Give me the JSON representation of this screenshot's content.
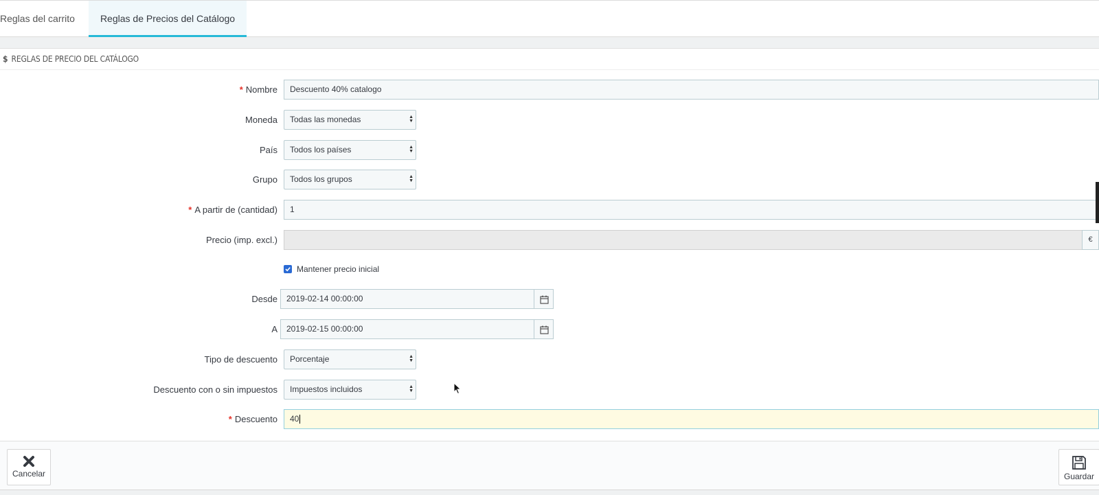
{
  "tabs": [
    {
      "label": "Reglas del carrito",
      "active": false
    },
    {
      "label": "Reglas de Precios del Catálogo",
      "active": true
    }
  ],
  "panel": {
    "currency_symbol": "$",
    "title": "Reglas de precio del catálogo"
  },
  "form": {
    "nombre": {
      "label": "Nombre",
      "required": true,
      "value": "Descuento 40% catalogo"
    },
    "moneda": {
      "label": "Moneda",
      "value": "Todas las monedas"
    },
    "pais": {
      "label": "País",
      "value": "Todos los países"
    },
    "grupo": {
      "label": "Grupo",
      "value": "Todos los grupos"
    },
    "cantidad": {
      "label": "A partir de (cantidad)",
      "required": true,
      "value": "1"
    },
    "precio": {
      "label": "Precio (imp. excl.)",
      "value": "",
      "addon": "€",
      "disabled": true
    },
    "mantener": {
      "label": "Mantener precio inicial",
      "checked": true
    },
    "desde": {
      "label": "Desde",
      "value": "2019-02-14 00:00:00"
    },
    "a": {
      "label": "A",
      "value": "2019-02-15 00:00:00"
    },
    "tipo": {
      "label": "Tipo de descuento",
      "value": "Porcentaje"
    },
    "impuestos": {
      "label": "Descuento con o sin impuestos",
      "value": "Impuestos incluidos"
    },
    "descuento": {
      "label": "Descuento",
      "required": true,
      "value": "40"
    }
  },
  "footer": {
    "cancel_label": "Cancelar",
    "save_label": "Guardar"
  },
  "icons": {
    "cancel": "close-icon",
    "save": "save-icon",
    "calendar": "calendar-icon",
    "select_arrows": "sort-arrows-icon"
  },
  "colors": {
    "accent": "#25b9d7",
    "required": "#e5332a",
    "checkbox": "#2a6ad4",
    "active_input": "#fefbe2"
  }
}
